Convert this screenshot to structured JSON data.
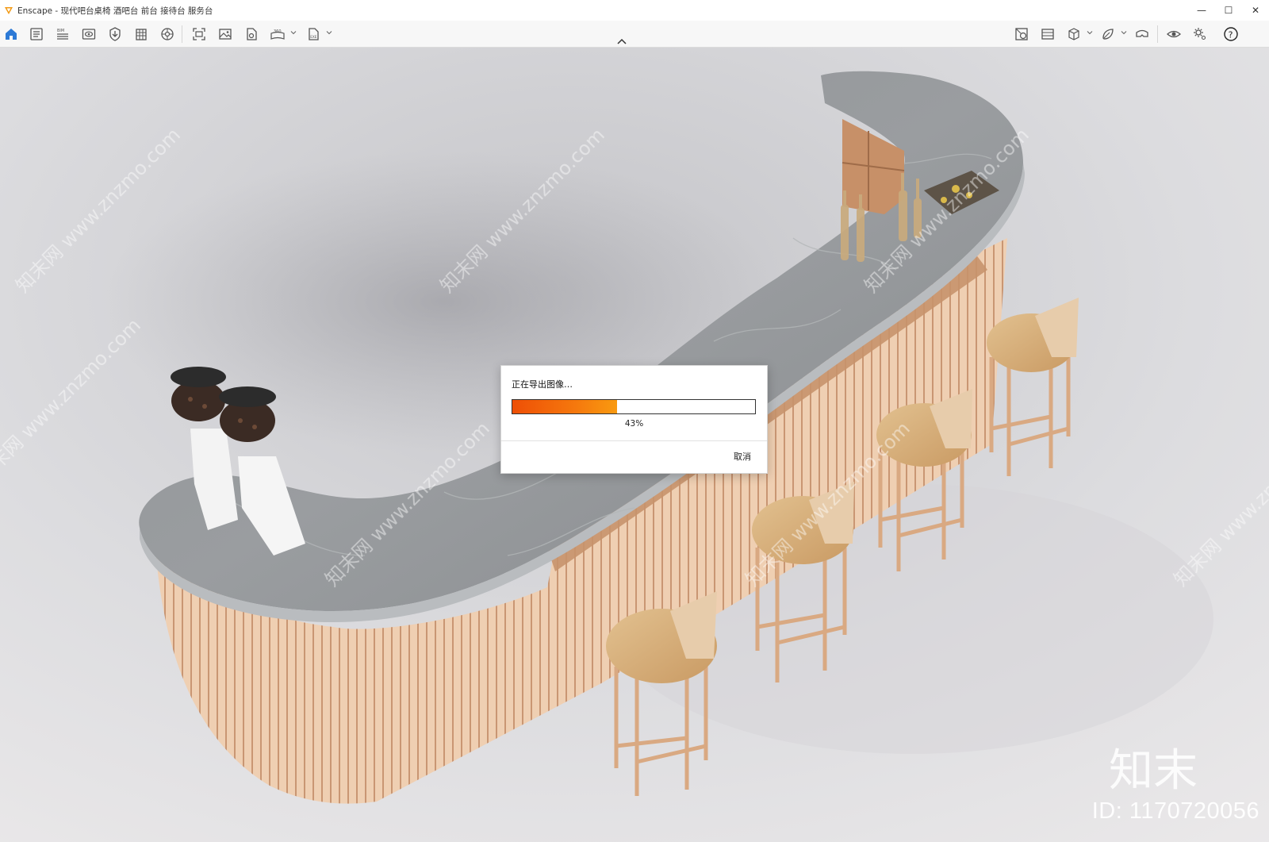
{
  "window": {
    "title": "Enscape - 现代吧台桌椅 酒吧台 前台 接待台 服务台",
    "controls": {
      "minimize": "—",
      "maximize": "☐",
      "close": "✕"
    },
    "app_icon": "enscape-logo-icon",
    "accent_color": "#f29a15"
  },
  "toolbar": {
    "left_icons": [
      "home-icon",
      "asset-library-icon",
      "bim-icon",
      "visual-settings-icon",
      "sync-icon",
      "building-icon",
      "site-context-icon",
      "screenshot-icon",
      "render-image-icon",
      "batch-render-icon",
      "panorama-360-icon",
      "export-exe-icon"
    ],
    "right_icons": [
      "material-editor-icon",
      "views-icon",
      "cube-icon",
      "plugin-icon",
      "vr-headset-icon",
      "visibility-icon",
      "settings-gear-icon",
      "help-icon"
    ],
    "bim_label": "BIM",
    "panorama_label": "360",
    "exe_label": "EXE",
    "help_label": "?",
    "collapse_icon": "chevron-up-icon"
  },
  "dialog": {
    "title": "正在导出图像…",
    "progress_percent": 43,
    "progress_label": "43%",
    "cancel_label": "取消",
    "progress_colors": [
      "#ee4f06",
      "#f99a10"
    ]
  },
  "watermark": {
    "logo_text": "知末",
    "id_text": "ID: 1170720056",
    "diagonal_text": "知末网 www.znzmo.com"
  }
}
